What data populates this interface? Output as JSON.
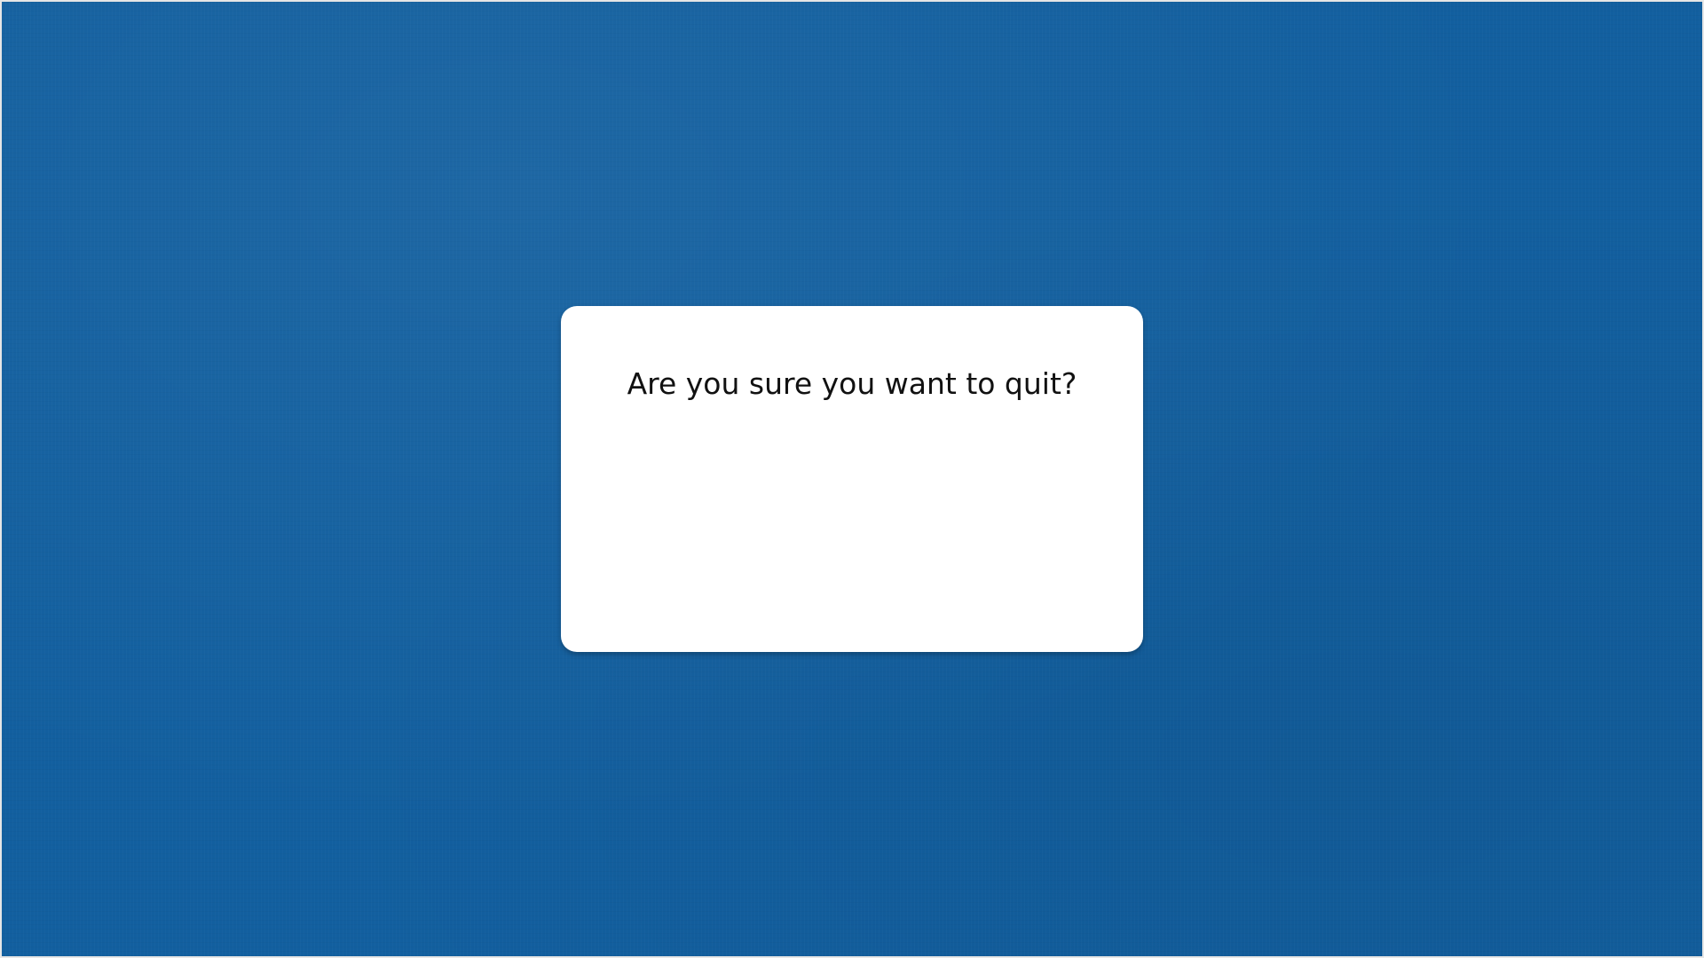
{
  "background": {
    "color": "#125f9f"
  },
  "dialog": {
    "message": "Are you sure you want to quit?"
  }
}
